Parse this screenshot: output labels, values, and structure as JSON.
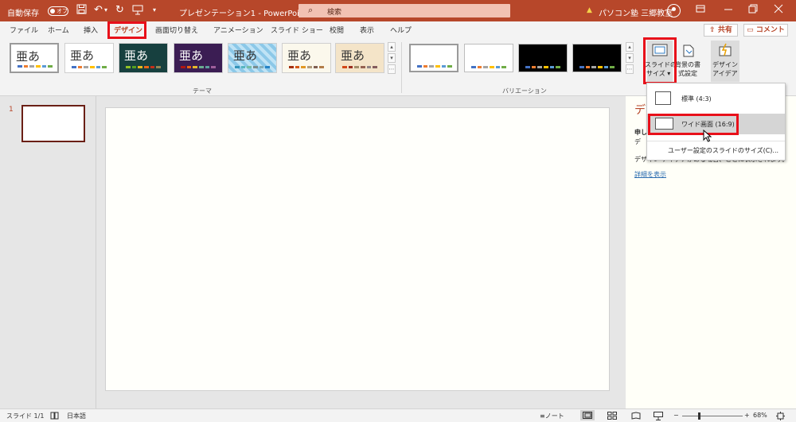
{
  "titlebar": {
    "autosave_label": "自動保存",
    "autosave_state": "オフ",
    "doc_title": "プレゼンテーション1  -  PowerPoint",
    "search_placeholder": "検索",
    "warning_glyph": "▲",
    "user_name": "パソコン塾 三郷教室",
    "icons": [
      "save-icon",
      "undo-icon",
      "redo-icon",
      "present-icon",
      "customize-icon",
      "search-icon",
      "warning-icon",
      "avatar",
      "ribbon-display-icon",
      "minimize-icon",
      "restore-icon",
      "close-icon"
    ],
    "accent_color": "#b7472a"
  },
  "tabs": [
    {
      "label": "ファイル"
    },
    {
      "label": "ホーム"
    },
    {
      "label": "挿入"
    },
    {
      "label": "デザイン"
    },
    {
      "label": "画面切り替え"
    },
    {
      "label": "アニメーション"
    },
    {
      "label": "スライド ショー"
    },
    {
      "label": "校閲"
    },
    {
      "label": "表示"
    },
    {
      "label": "ヘルプ"
    }
  ],
  "share_label": "共有",
  "comment_label": "コメント",
  "ribbon": {
    "themes_group_label": "テーマ",
    "theme_glyph": "亜あ",
    "variations_group_label": "バリエーション",
    "slide_size": {
      "line1": "スライドの",
      "line2": "サイズ ▾"
    },
    "bg_format": {
      "line1": "背景の書",
      "line2": "式設定"
    },
    "design_ideas": {
      "line1": "デザイン",
      "line2": "アイデア"
    }
  },
  "dropdown": {
    "items": [
      {
        "label": "標準 (4:3)"
      },
      {
        "label": "ワイド画面 (16:9)"
      },
      {
        "label": "ユーザー設定のスライドのサイズ(C)..."
      }
    ]
  },
  "thumbnail_number": "1",
  "design_pane": {
    "title_partial": "デ",
    "line1_partial": "申し",
    "line2_partial": "デ",
    "body": "デザイン アイデアがある場合、ここに表示されます。",
    "link": "詳細を表示"
  },
  "statusbar": {
    "slide_counter": "スライド 1/1",
    "language": "日本語",
    "notes_label": "ノート",
    "zoom_minus": "−",
    "zoom_plus": "+",
    "zoom_level": "68%"
  }
}
